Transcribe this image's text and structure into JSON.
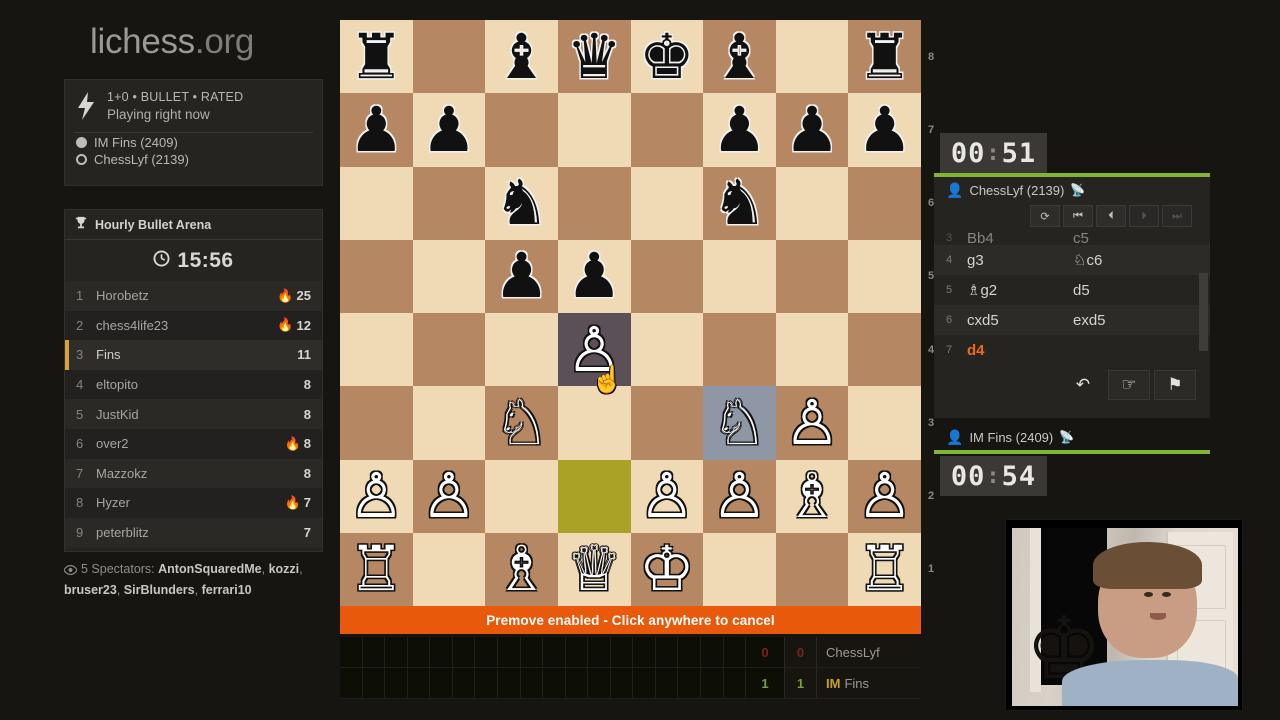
{
  "site": {
    "name_main": "lichess",
    "name_tld": ".org"
  },
  "game_info": {
    "bolt_icon": "bolt-icon",
    "line1": "1+0 • BULLET • RATED",
    "line2": "Playing right now",
    "players": [
      {
        "name": "IM Fins (2409)",
        "color": "white"
      },
      {
        "name": "ChessLyf (2139)",
        "color": "black"
      }
    ]
  },
  "tournament": {
    "trophy_icon": "trophy-icon",
    "title": "Hourly Bullet Arena",
    "clock_icon": "clock-icon",
    "clock": "15:56",
    "standings": [
      {
        "rank": "1",
        "name": "Horobetz",
        "score": "25",
        "fire": true,
        "me": false
      },
      {
        "rank": "2",
        "name": "chess4life23",
        "score": "12",
        "fire": true,
        "me": false
      },
      {
        "rank": "3",
        "name": "Fins",
        "score": "11",
        "fire": false,
        "me": true
      },
      {
        "rank": "4",
        "name": "eltopito",
        "score": "8",
        "fire": false,
        "me": false
      },
      {
        "rank": "5",
        "name": "JustKid",
        "score": "8",
        "fire": false,
        "me": false
      },
      {
        "rank": "6",
        "name": "over2",
        "score": "8",
        "fire": true,
        "me": false
      },
      {
        "rank": "7",
        "name": "Mazzokz",
        "score": "8",
        "fire": false,
        "me": false
      },
      {
        "rank": "8",
        "name": "Hyzer",
        "score": "7",
        "fire": true,
        "me": false
      },
      {
        "rank": "9",
        "name": "peterblitz",
        "score": "7",
        "fire": false,
        "me": false
      }
    ]
  },
  "spectators": {
    "eye_icon": "eye-icon",
    "label": "5 Spectators:",
    "names": [
      "AntonSquaredMe",
      "kozzi",
      "bruser23",
      "SirBlunders",
      "ferrari10"
    ]
  },
  "board": {
    "orientation": "white",
    "light_color": "#f0d9b5",
    "dark_color": "#b58863",
    "last_move_color": "#5b5057",
    "selected_color": "#8f96a5",
    "premove_color": "#a9a227",
    "rank_labels": [
      "8",
      "7",
      "6",
      "5",
      "4",
      "3",
      "2",
      "1"
    ],
    "highlight_squares": {
      "last_move": [
        "d4"
      ],
      "selected": [
        "f3"
      ],
      "premove": [
        "d2"
      ]
    },
    "rows": [
      [
        "r",
        "",
        "b",
        "q",
        "k",
        "b",
        "",
        "r"
      ],
      [
        "p",
        "p",
        "",
        "",
        "",
        "p",
        "p",
        "p"
      ],
      [
        "",
        "",
        "n",
        "",
        "",
        "n",
        "",
        ""
      ],
      [
        "",
        "",
        "p",
        "p",
        "",
        "",
        "",
        ""
      ],
      [
        "",
        "",
        "",
        "P",
        "",
        "",
        "",
        ""
      ],
      [
        "",
        "",
        "N",
        "",
        "",
        "N",
        "P",
        ""
      ],
      [
        "P",
        "P",
        "",
        "",
        "P",
        "P",
        "B",
        "P"
      ],
      [
        "R",
        "",
        "B",
        "Q",
        "K",
        "",
        "",
        "R"
      ]
    ]
  },
  "premove_banner": {
    "text": "Premove enabled - Click anywhere to cancel"
  },
  "score_strip": {
    "rows": [
      {
        "score_a": "0",
        "score_b": "0",
        "title": "",
        "name": "ChessLyf",
        "result": "loss"
      },
      {
        "score_a": "1",
        "score_b": "1",
        "title": "IM",
        "name": "Fins",
        "result": "win"
      }
    ]
  },
  "right_panel": {
    "clock_top": {
      "minutes": "00",
      "sep": ":",
      "seconds": "51"
    },
    "clock_bottom": {
      "minutes": "00",
      "sep": ":",
      "seconds": "54"
    },
    "top_player": {
      "user_icon": "user-icon",
      "name": "ChessLyf (2139)",
      "rss_icon": "rss-icon"
    },
    "bottom_player": {
      "user_icon": "user-icon",
      "name": "IM Fins (2409)",
      "rss_icon": "rss-icon"
    },
    "nav_buttons": [
      {
        "icon": "flip-board-icon",
        "glyph": "⟳",
        "enabled": true
      },
      {
        "icon": "first-move-icon",
        "glyph": "⏮",
        "enabled": true
      },
      {
        "icon": "prev-move-icon",
        "glyph": "⏴",
        "enabled": true
      },
      {
        "icon": "next-move-icon",
        "glyph": "⏵",
        "enabled": false
      },
      {
        "icon": "last-move-icon",
        "glyph": "⏭",
        "enabled": false
      }
    ],
    "moves": [
      {
        "num": "3",
        "white": "Bb4",
        "black": "c5",
        "clipped": true,
        "current": false
      },
      {
        "num": "4",
        "white": "g3",
        "black": "♘c6",
        "clipped": false,
        "current": false
      },
      {
        "num": "5",
        "white": "♗g2",
        "black": "d5",
        "clipped": false,
        "current": false
      },
      {
        "num": "6",
        "white": "cxd5",
        "black": "exd5",
        "clipped": false,
        "current": false
      },
      {
        "num": "7",
        "white": "d4",
        "black": "",
        "clipped": false,
        "current": true
      }
    ],
    "current_move_color": "#ef6c17",
    "action_buttons": [
      {
        "icon": "takeback-icon",
        "glyph": "↶",
        "name": "takeback-button"
      },
      {
        "icon": "draw-offer-icon",
        "glyph": "☞",
        "name": "draw-offer-button"
      },
      {
        "icon": "resign-flag-icon",
        "glyph": "⚑",
        "name": "resign-button"
      }
    ]
  },
  "webcam": {
    "label": "streamer-webcam"
  }
}
